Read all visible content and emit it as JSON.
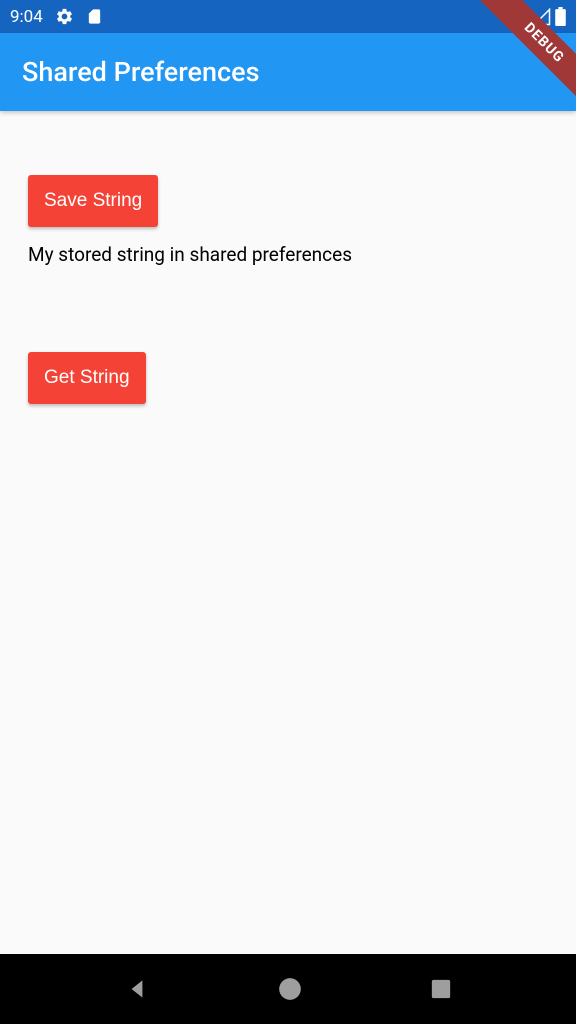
{
  "status": {
    "time": "9:04"
  },
  "appbar": {
    "title": "Shared Preferences"
  },
  "buttons": {
    "save": "Save String",
    "get": "Get String"
  },
  "content": {
    "stored_text": "My stored string in shared preferences"
  },
  "debug": {
    "label": "DEBUG"
  }
}
